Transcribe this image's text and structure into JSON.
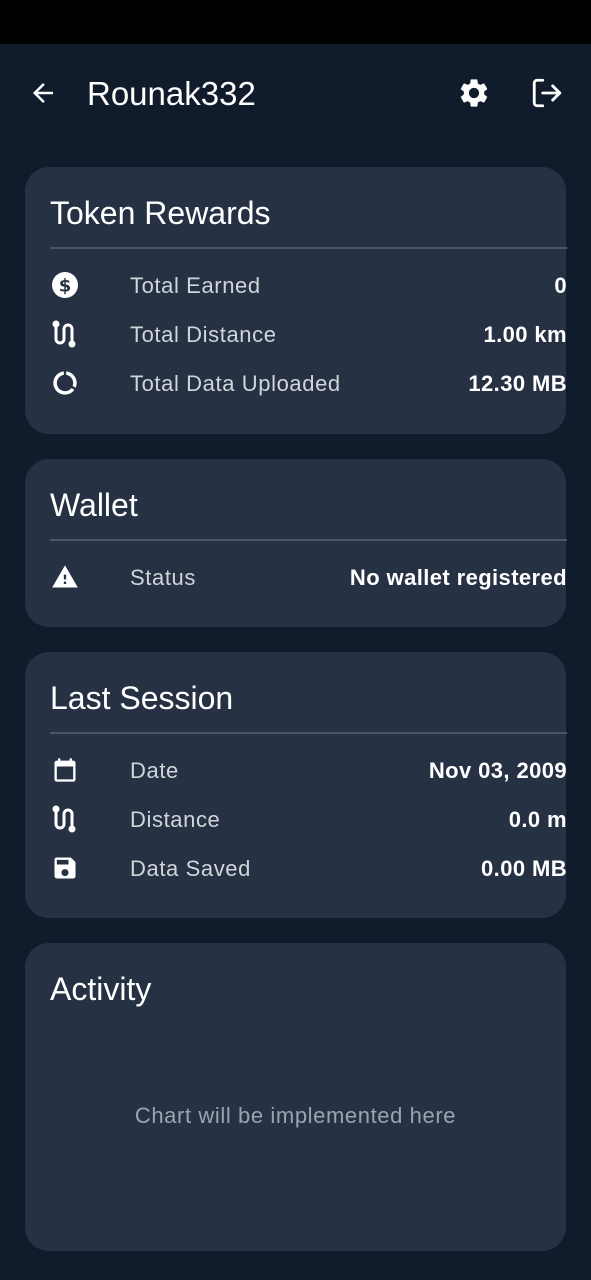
{
  "app_bar": {
    "title": "Rounak332",
    "back_icon": "arrow-left-icon",
    "settings_icon": "gear-icon",
    "logout_icon": "logout-icon"
  },
  "token_rewards": {
    "title": "Token Rewards",
    "rows": [
      {
        "icon": "dollar-circle-icon",
        "label": "Total Earned",
        "value": "0"
      },
      {
        "icon": "route-icon",
        "label": "Total Distance",
        "value": "1.00 km"
      },
      {
        "icon": "data-usage-icon",
        "label": "Total Data Uploaded",
        "value": "12.30 MB"
      }
    ]
  },
  "wallet": {
    "title": "Wallet",
    "rows": [
      {
        "icon": "warning-icon",
        "label": "Status",
        "value": "No wallet registered"
      }
    ]
  },
  "last_session": {
    "title": "Last Session",
    "rows": [
      {
        "icon": "calendar-icon",
        "label": "Date",
        "value": "Nov 03, 2009"
      },
      {
        "icon": "route-icon",
        "label": "Distance",
        "value": "0.0 m"
      },
      {
        "icon": "save-icon",
        "label": "Data Saved",
        "value": "0.00 MB"
      }
    ]
  },
  "activity": {
    "title": "Activity",
    "placeholder": "Chart will be implemented here"
  },
  "colors": {
    "background": "#101b2b",
    "card": "#263244",
    "divider": "#4a5566",
    "label": "#d1d5db",
    "placeholder": "#9aa3b0"
  }
}
